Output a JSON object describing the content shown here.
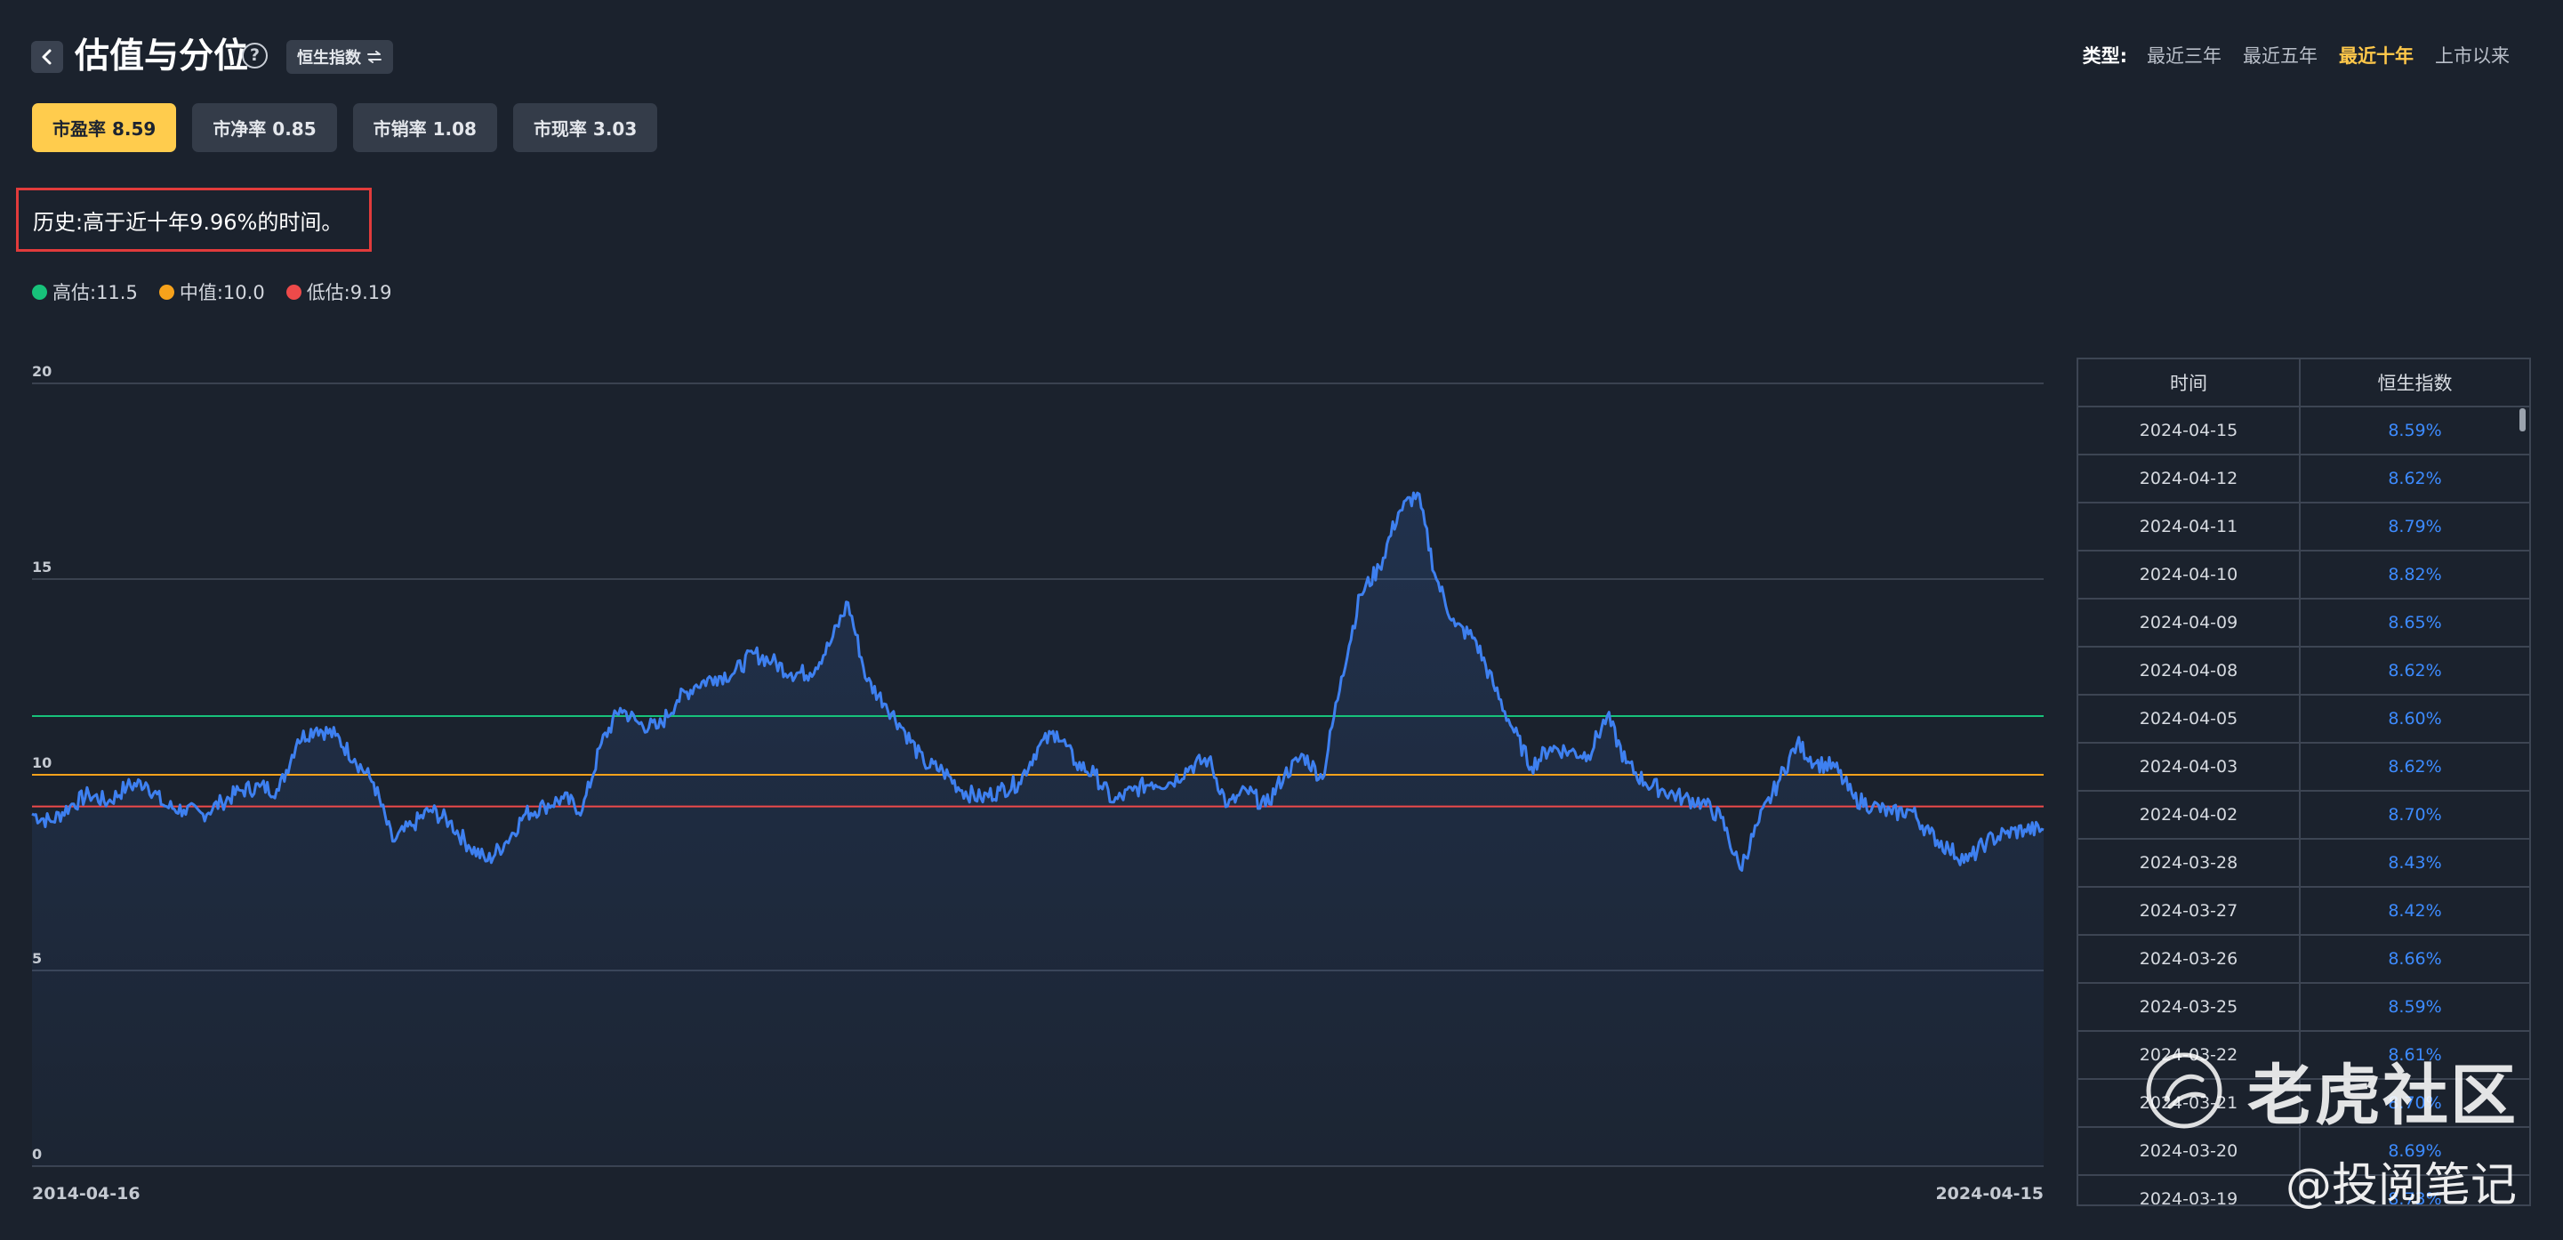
{
  "header": {
    "title": "估值与分位",
    "index_switch_label": "恒生指数",
    "type_label": "类型:",
    "type_options": [
      {
        "label": "最近三年",
        "active": false
      },
      {
        "label": "最近五年",
        "active": false
      },
      {
        "label": "最近十年",
        "active": true
      },
      {
        "label": "上市以来",
        "active": false
      }
    ]
  },
  "metric_tabs": [
    {
      "label": "市盈率 8.59",
      "active": true
    },
    {
      "label": "市净率 0.85",
      "active": false
    },
    {
      "label": "市销率 1.08",
      "active": false
    },
    {
      "label": "市现率 3.03",
      "active": false
    }
  ],
  "history_text": "历史:高于近十年9.96%的时间。",
  "legend": [
    {
      "label": "高估:11.5",
      "color": "#17c27a"
    },
    {
      "label": "中值:10.0",
      "color": "#f7a21b"
    },
    {
      "label": "低估:9.19",
      "color": "#ee4a4a"
    }
  ],
  "chart_data": {
    "type": "line",
    "series": [
      {
        "values": [
          9.0,
          8.8,
          9.2,
          9.5,
          9.3,
          9.7,
          9.8,
          9.2,
          9.1,
          9.0,
          9.3,
          9.6,
          9.7,
          9.6,
          10.9,
          11.2,
          11.0,
          10.4,
          9.8,
          8.3,
          8.7,
          9.1,
          8.8,
          8.2,
          7.8,
          8.3,
          9.0,
          9.2,
          9.4,
          9.1,
          10.8,
          11.7,
          11.3,
          11.2,
          11.9,
          12.3,
          12.5,
          12.6,
          13.1,
          12.9,
          12.6,
          12.6,
          13.3,
          14.4,
          12.4,
          11.8,
          11.1,
          10.3,
          10.1,
          9.6,
          9.4,
          9.6,
          9.8,
          10.7,
          11.1,
          10.3,
          10.0,
          9.3,
          9.6,
          9.8,
          9.8,
          10.2,
          10.4,
          9.2,
          9.6,
          9.2,
          10.0,
          10.5,
          9.9,
          12.5,
          14.6,
          15.3,
          16.7,
          17.2,
          15.0,
          13.8,
          13.5,
          12.3,
          11.2,
          10.2,
          10.7,
          10.6,
          10.5,
          11.5,
          10.3,
          9.8,
          9.6,
          9.4,
          9.3,
          8.9,
          7.6,
          8.8,
          9.8,
          10.8,
          10.3,
          10.2,
          9.4,
          9.2,
          9.0,
          9.1,
          8.5,
          8.1,
          7.8,
          8.3,
          8.5,
          8.6,
          8.59
        ]
      }
    ],
    "reference_lines": [
      {
        "name": "高估",
        "value": 11.5,
        "color": "#17c27a"
      },
      {
        "name": "中值",
        "value": 10.0,
        "color": "#f7a21b"
      },
      {
        "name": "低估",
        "value": 9.19,
        "color": "#ee4a4a"
      }
    ],
    "ylim": [
      0,
      20
    ],
    "y_ticks": [
      "20",
      "15",
      "10",
      "5",
      "0"
    ],
    "x_tick_labels": [
      "2014-04-16",
      "2024-04-15"
    ],
    "line_color": "#3e80f0",
    "grid": true
  },
  "table": {
    "headers": [
      "时间",
      "恒生指数"
    ],
    "rows": [
      {
        "date": "2024-04-15",
        "value": "8.59%"
      },
      {
        "date": "2024-04-12",
        "value": "8.62%"
      },
      {
        "date": "2024-04-11",
        "value": "8.79%"
      },
      {
        "date": "2024-04-10",
        "value": "8.82%"
      },
      {
        "date": "2024-04-09",
        "value": "8.65%"
      },
      {
        "date": "2024-04-08",
        "value": "8.62%"
      },
      {
        "date": "2024-04-05",
        "value": "8.60%"
      },
      {
        "date": "2024-04-03",
        "value": "8.62%"
      },
      {
        "date": "2024-04-02",
        "value": "8.70%"
      },
      {
        "date": "2024-03-28",
        "value": "8.43%"
      },
      {
        "date": "2024-03-27",
        "value": "8.42%"
      },
      {
        "date": "2024-03-26",
        "value": "8.66%"
      },
      {
        "date": "2024-03-25",
        "value": "8.59%"
      },
      {
        "date": "2024-03-22",
        "value": "8.61%"
      },
      {
        "date": "2024-03-21",
        "value": "8.70%"
      },
      {
        "date": "2024-03-20",
        "value": "8.69%"
      },
      {
        "date": "2024-03-19",
        "value": "8.73%"
      }
    ]
  },
  "watermark": {
    "brand": "老虎社区",
    "author": "@投阅笔记"
  }
}
